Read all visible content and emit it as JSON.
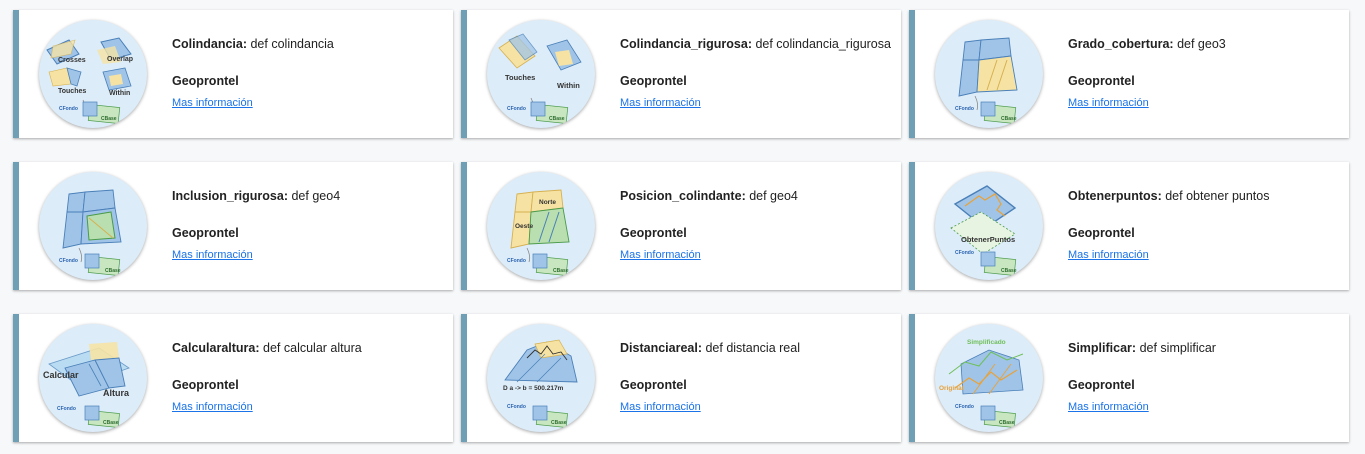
{
  "cards": [
    {
      "name": "Colindancia",
      "description": "def colindancia",
      "owner": "Geoprontel",
      "link": "Mas información",
      "thumb": {
        "labels": [
          "Crosses",
          "Overlap",
          "Touches",
          "Within",
          "CFondo",
          "CBase"
        ]
      }
    },
    {
      "name": "Colindancia_rigurosa",
      "description": "def colindancia_rigurosa",
      "owner": "Geoprontel",
      "link": "Mas información",
      "thumb": {
        "labels": [
          "Touches",
          "Within",
          "CFondo",
          "CBase"
        ]
      }
    },
    {
      "name": "Grado_cobertura",
      "description": "def geo3",
      "owner": "Geoprontel",
      "link": "Mas información",
      "thumb": {
        "labels": [
          "CFondo",
          "CBase"
        ]
      }
    },
    {
      "name": "Inclusion_rigurosa",
      "description": "def geo4",
      "owner": "Geoprontel",
      "link": "Mas información",
      "thumb": {
        "labels": [
          "CFondo",
          "CBase"
        ]
      }
    },
    {
      "name": "Posicion_colindante",
      "description": "def geo4",
      "owner": "Geoprontel",
      "link": "Mas información",
      "thumb": {
        "labels": [
          "Norte",
          "Oeste",
          "CFondo",
          "CBase"
        ]
      }
    },
    {
      "name": "Obtenerpuntos",
      "description": "def obtener puntos",
      "owner": "Geoprontel",
      "link": "Mas información",
      "thumb": {
        "labels": [
          "ObtenerPuntos",
          "CFondo",
          "CBase"
        ]
      }
    },
    {
      "name": "Calcularaltura",
      "description": "def calcular altura",
      "owner": "Geoprontel",
      "link": "Mas información",
      "thumb": {
        "labels": [
          "Calcular",
          "Altura",
          "CFondo",
          "CBase"
        ]
      }
    },
    {
      "name": "Distanciareal",
      "description": "def distancia real",
      "owner": "Geoprontel",
      "link": "Mas información",
      "thumb": {
        "labels": [
          "D a -> b = 500.217m",
          "CFondo",
          "CBase"
        ]
      }
    },
    {
      "name": "Simplificar",
      "description": "def simplificar",
      "owner": "Geoprontel",
      "link": "Mas información",
      "thumb": {
        "labels": [
          "Simplificado",
          "Original",
          "CFondo",
          "CBase"
        ]
      }
    }
  ],
  "colors": {
    "accent": "#6f9fb4",
    "link": "#1a73e8",
    "thumb_bg": "#dcecf8",
    "poly_blue": "#9fc4e8",
    "poly_yellow": "#f6e3a4",
    "poly_green": "#b9dfb0"
  }
}
